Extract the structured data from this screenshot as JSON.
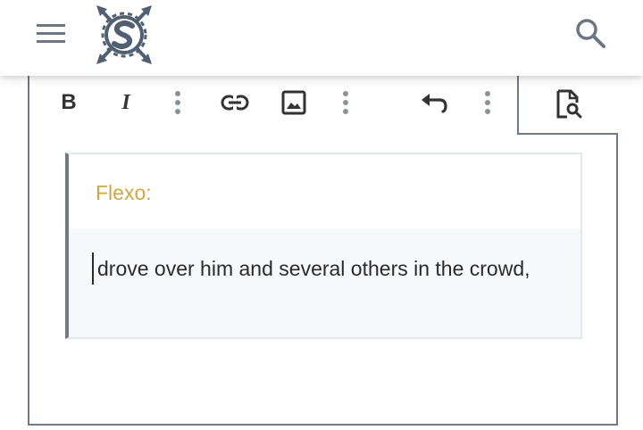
{
  "app_bar": {
    "menu_icon": "menu-icon",
    "logo_icon": "site-logo",
    "search_icon": "search-icon"
  },
  "toolbar": {
    "buttons": [
      {
        "name": "bold-button",
        "label": "B"
      },
      {
        "name": "italic-button",
        "label": "I"
      },
      {
        "name": "more-vert-icon"
      },
      {
        "name": "link-icon"
      },
      {
        "name": "image-icon"
      },
      {
        "name": "more-vert-icon"
      },
      {
        "name": "undo-icon"
      },
      {
        "name": "more-vert-icon"
      },
      {
        "name": "preview-icon"
      }
    ],
    "bold_label": "B",
    "italic_label": "I"
  },
  "quote": {
    "author": "Flexo:",
    "text": "drove over him and several others in the crowd,"
  },
  "colors": {
    "accent_author": "#d6a63a",
    "frame": "#6c7a89",
    "quote_bg": "#f7f8fa"
  }
}
